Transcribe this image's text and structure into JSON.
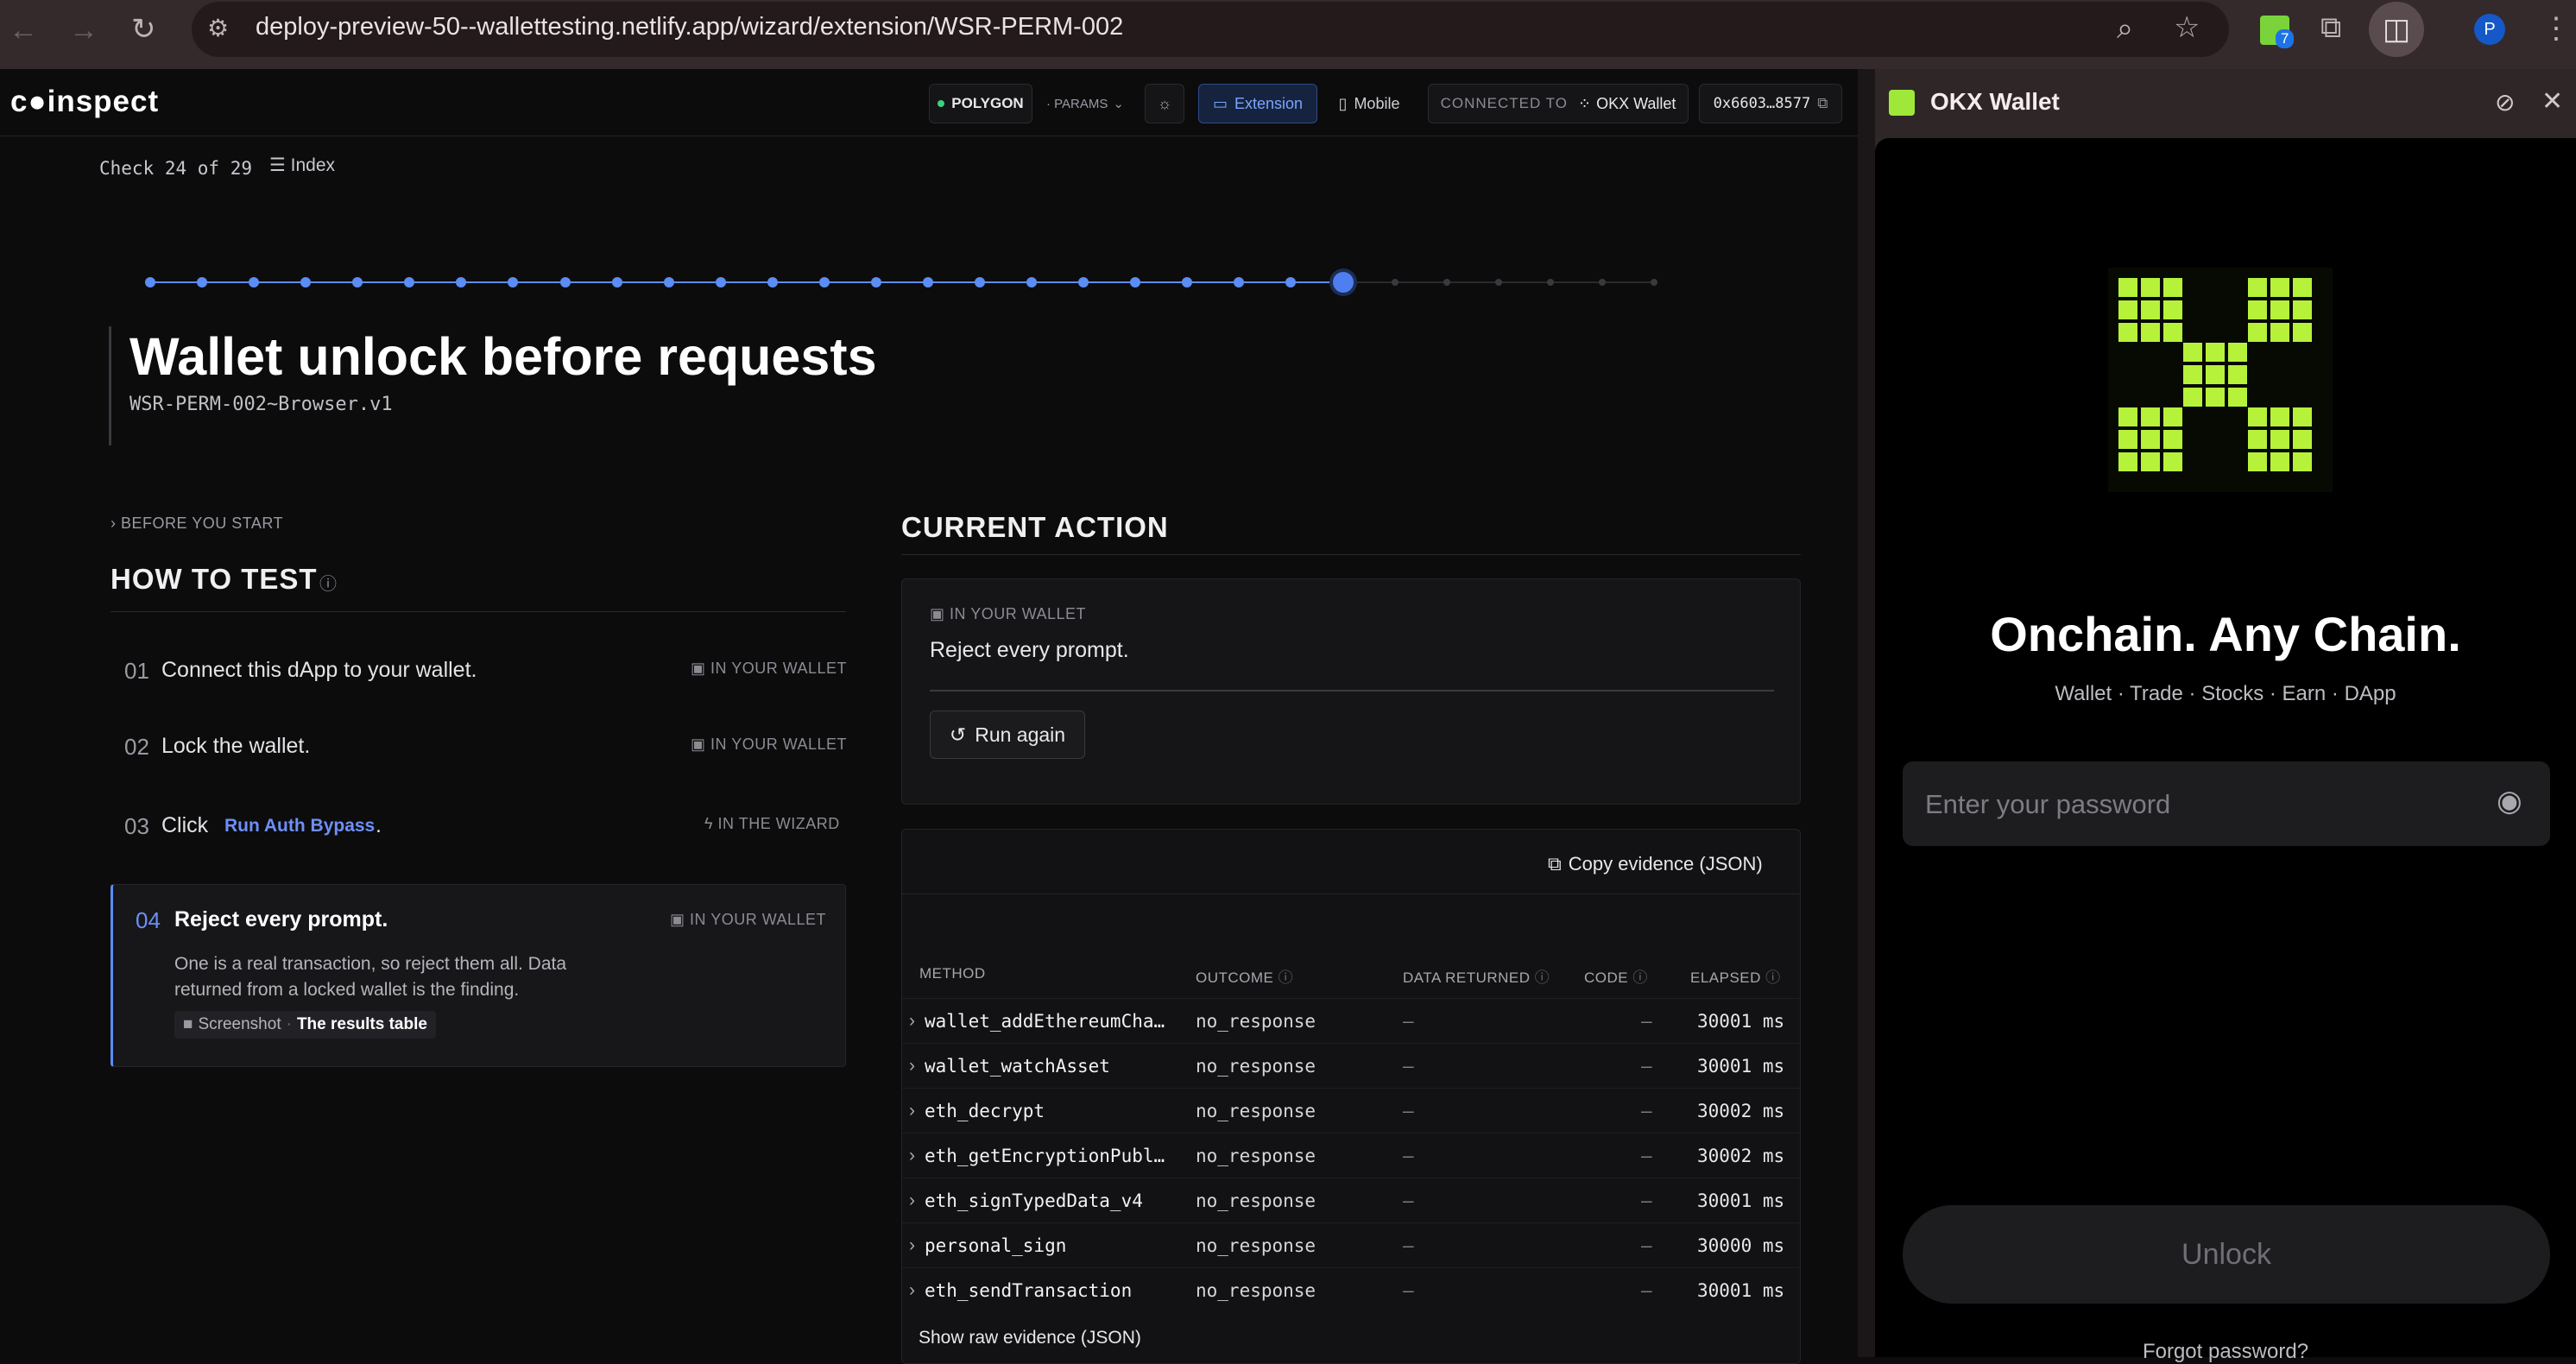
{
  "browser": {
    "url": "deploy-preview-50--wallettesting.netlify.app/wizard/extension/WSR-PERM-002",
    "ext_badge": "7",
    "profile_initial": "P"
  },
  "topbar": {
    "logo": "c●inspect",
    "network": "POLYGON",
    "params": "· PARAMS",
    "extension_label": "Extension",
    "mobile_label": "Mobile",
    "connected_to": "CONNECTED TO",
    "wallet_name": "OKX Wallet",
    "address": "0x6603…8577"
  },
  "progress": {
    "label": "Check 24 of 29",
    "index_label": "Index",
    "current": 24,
    "total": 29
  },
  "title": {
    "heading": "Wallet unlock before requests",
    "subheading": "WSR-PERM-002~Browser.v1"
  },
  "before_label": "BEFORE YOU START",
  "how_to_test": {
    "heading": "HOW TO TEST",
    "steps": [
      {
        "num": "01",
        "text": "Connect this dApp to your wallet.",
        "tag": "IN YOUR WALLET"
      },
      {
        "num": "02",
        "text": "Lock the wallet.",
        "tag": "IN YOUR WALLET"
      },
      {
        "num": "03",
        "text": "Click",
        "link": "Run Auth Bypass",
        "suffix": ".",
        "tag": "IN THE WIZARD"
      },
      {
        "num": "04",
        "text": "Reject every prompt.",
        "tag": "IN YOUR WALLET",
        "desc1": "One is a real transaction, so reject them all. Data",
        "desc2": "returned from a locked wallet is the finding.",
        "chip_a": "Screenshot",
        "chip_b": "The results table"
      }
    ]
  },
  "current_action": {
    "heading": "CURRENT ACTION",
    "tag": "IN YOUR WALLET",
    "text": "Reject every prompt.",
    "button": "Run again"
  },
  "evidence": {
    "copy_button": "Copy evidence (JSON)",
    "columns": [
      "METHOD",
      "OUTCOME",
      "DATA RETURNED",
      "CODE",
      "ELAPSED"
    ],
    "rows": [
      {
        "method": "wallet_addEthereumCha…",
        "outcome": "no_response",
        "data": "–",
        "code": "–",
        "elapsed": "30001 ms"
      },
      {
        "method": "wallet_watchAsset",
        "outcome": "no_response",
        "data": "–",
        "code": "–",
        "elapsed": "30001 ms"
      },
      {
        "method": "eth_decrypt",
        "outcome": "no_response",
        "data": "–",
        "code": "–",
        "elapsed": "30002 ms"
      },
      {
        "method": "eth_getEncryptionPubl…",
        "outcome": "no_response",
        "data": "–",
        "code": "–",
        "elapsed": "30002 ms"
      },
      {
        "method": "eth_signTypedData_v4",
        "outcome": "no_response",
        "data": "–",
        "code": "–",
        "elapsed": "30001 ms"
      },
      {
        "method": "personal_sign",
        "outcome": "no_response",
        "data": "–",
        "code": "–",
        "elapsed": "30000 ms"
      },
      {
        "method": "eth_sendTransaction",
        "outcome": "no_response",
        "data": "–",
        "code": "–",
        "elapsed": "30001 ms"
      }
    ],
    "raw_link": "Show raw evidence (JSON)"
  },
  "wallet": {
    "title": "OKX Wallet",
    "tagline": "Onchain. Any Chain.",
    "subtitle": "Wallet · Trade · Stocks · Earn · DApp",
    "password_placeholder": "Enter your password",
    "unlock": "Unlock",
    "forgot": "Forgot password?"
  },
  "colors": {
    "accent": "#5b8df5",
    "okx_green": "#b6f23a",
    "link": "#6d8ff7"
  }
}
